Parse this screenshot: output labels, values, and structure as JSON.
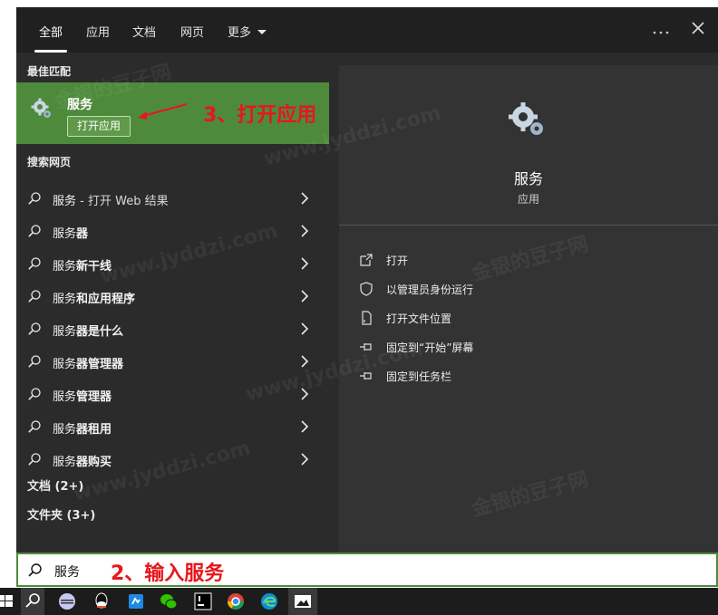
{
  "tabs": [
    {
      "label": "全部"
    },
    {
      "label": "应用"
    },
    {
      "label": "文档"
    },
    {
      "label": "网页"
    },
    {
      "label": "更多"
    }
  ],
  "more_icon": "ellipsis-icon",
  "close_icon": "close-icon",
  "best_match": {
    "section_label": "最佳匹配",
    "name": "服务",
    "open_label": "打开应用"
  },
  "web_section": {
    "label": "搜索网页"
  },
  "web_results": [
    {
      "prefix": "服务",
      "suffix": " - 打开 Web 结果"
    },
    {
      "prefix": "服务",
      "suffix": "器"
    },
    {
      "prefix": "服务",
      "suffix": "新干线"
    },
    {
      "prefix": "服务",
      "suffix": "和应用程序"
    },
    {
      "prefix": "服务",
      "suffix": "器是什么"
    },
    {
      "prefix": "服务",
      "suffix": "器管理器"
    },
    {
      "prefix": "服务",
      "suffix": "管理器"
    },
    {
      "prefix": "服务",
      "suffix": "器租用"
    },
    {
      "prefix": "服务",
      "suffix": "器购买"
    }
  ],
  "documents_section": {
    "label": "文档 (2+)"
  },
  "folders_section": {
    "label": "文件夹 (3+)"
  },
  "preview": {
    "name": "服务",
    "type": "应用"
  },
  "actions": [
    {
      "label": "打开",
      "icon": "open-icon"
    },
    {
      "label": "以管理员身份运行",
      "icon": "shield-icon"
    },
    {
      "label": "打开文件位置",
      "icon": "file-location-icon"
    },
    {
      "label": "固定到“开始”屏幕",
      "icon": "pin-icon"
    },
    {
      "label": "固定到任务栏",
      "icon": "pin-icon"
    }
  ],
  "search": {
    "value": "服务"
  },
  "annotations": {
    "step3": "3、打开应用",
    "step2": "2、输入服务",
    "color": "#e8161b"
  },
  "colors": {
    "accent": "#4e8a3c",
    "panel": "#2b2b2b",
    "topbar": "#202020",
    "preview": "#333333"
  },
  "watermark": {
    "line1": "金银的豆子网",
    "line2": "www.jyddzi.com"
  },
  "taskbar": [
    "windows-start-icon",
    "search-icon",
    "app-icon",
    "qq-icon",
    "app-blue-icon",
    "wechat-icon",
    "ide-icon",
    "chrome-icon",
    "edge-icon",
    "photos-icon"
  ]
}
